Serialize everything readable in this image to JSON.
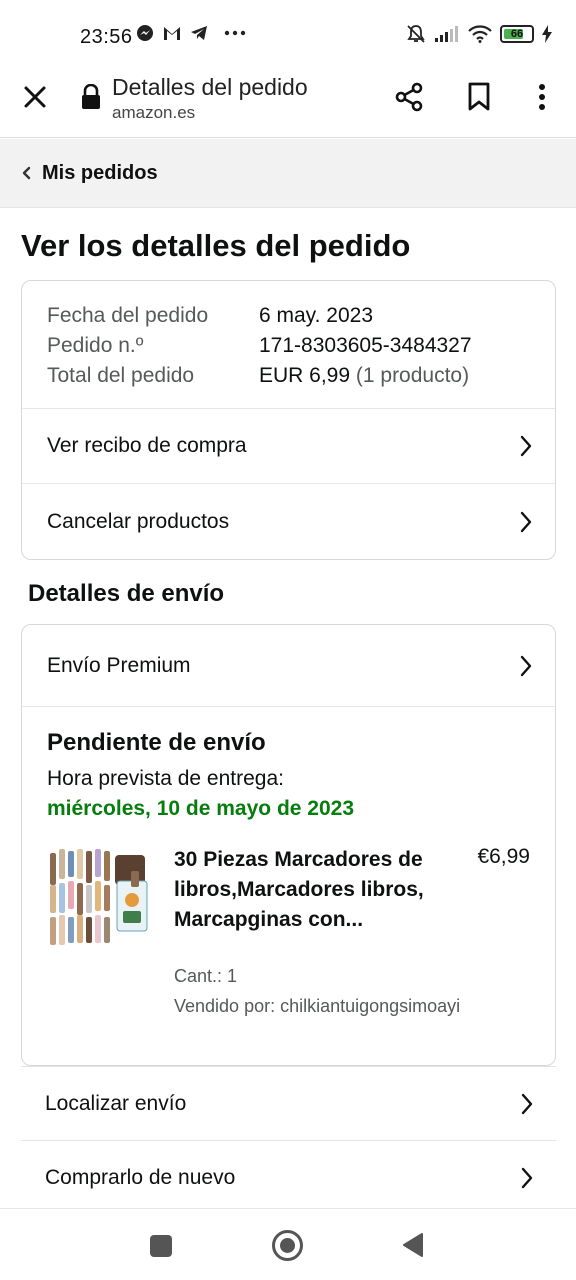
{
  "status_bar": {
    "time": "23:56",
    "battery": "66",
    "icons": [
      "messenger-icon",
      "gmail-icon",
      "telegram-icon",
      "more-dots-icon",
      "mute-bell-icon",
      "signal-icon",
      "wifi-icon",
      "battery-icon",
      "charging-icon"
    ]
  },
  "browser": {
    "title": "Detalles del pedido",
    "url": "amazon.es"
  },
  "breadcrumb": {
    "label": "Mis pedidos"
  },
  "page": {
    "heading": "Ver los detalles del pedido"
  },
  "summary": {
    "rows": [
      {
        "key": "Fecha del pedido",
        "value": "6 may. 2023",
        "extra": ""
      },
      {
        "key": "Pedido n.º",
        "value": "171-8303605-3484327",
        "extra": ""
      },
      {
        "key": "Total del pedido",
        "value": "EUR 6,99",
        "extra": " (1 producto)"
      }
    ],
    "links": [
      "Ver recibo de compra",
      "Cancelar productos"
    ]
  },
  "shipping": {
    "section_title": "Detalles de envío",
    "method": "Envío Premium",
    "status": "Pendiente de envío",
    "eta_label": "Hora prevista de entrega:",
    "eta_date": "miércoles, 10 de mayo de 2023",
    "accent_color": "#067d0d",
    "product": {
      "title": "30 Piezas Marcadores de libros,Marcadores libros, Marcapginas con...",
      "price": "€6,99",
      "qty": "Cant.: 1",
      "seller": "Vendido por: chilkiantuigongsimoayi"
    }
  },
  "bottom_links": [
    "Localizar envío",
    "Comprarlo de nuevo"
  ]
}
